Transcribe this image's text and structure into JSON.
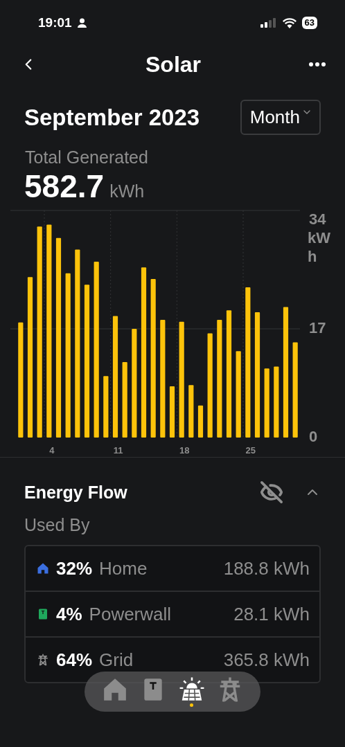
{
  "status_bar": {
    "time": "19:01",
    "battery": "63"
  },
  "nav": {
    "title": "Solar"
  },
  "period": {
    "label": "September 2023",
    "range": "Month"
  },
  "total": {
    "label": "Total Generated",
    "value": "582.7",
    "unit": "kWh"
  },
  "chart_data": {
    "type": "bar",
    "ylabel": "kWh",
    "x": [
      1,
      2,
      3,
      4,
      5,
      6,
      7,
      8,
      9,
      10,
      11,
      12,
      13,
      14,
      15,
      16,
      17,
      18,
      19,
      20,
      21,
      22,
      23,
      24,
      25,
      26,
      27,
      28,
      29,
      30
    ],
    "series": [
      {
        "color": "#fdc30a",
        "values": [
          18.0,
          25.1,
          33.0,
          33.3,
          31.2,
          25.7,
          29.4,
          23.9,
          27.5,
          9.6,
          19.0,
          11.8,
          17.0,
          26.6,
          24.8,
          18.4,
          8.0,
          18.1,
          8.2,
          5.0,
          16.3,
          18.4,
          19.9,
          13.5,
          23.5,
          19.6,
          10.8,
          11.1,
          20.4,
          14.9
        ]
      }
    ],
    "xlim": [
      0.5,
      30.5
    ],
    "ylim": [
      0,
      34
    ],
    "yticks": [
      0,
      17,
      34
    ],
    "xticks": [
      4,
      11,
      18,
      25
    ]
  },
  "energy_flow": {
    "title": "Energy Flow",
    "expanded": true,
    "subtitle": "Used By",
    "rows": [
      {
        "kind": "home",
        "color": "#3b6fe0",
        "percent": "32%",
        "label": "Home",
        "value": "188.8 kWh"
      },
      {
        "kind": "powerwall",
        "color": "#1fa85c",
        "percent": "4%",
        "label": "Powerwall",
        "value": "28.1 kWh"
      },
      {
        "kind": "grid",
        "color": "#8e8e8e",
        "percent": "64%",
        "label": "Grid",
        "value": "365.8 kWh"
      }
    ]
  },
  "tab_bar": [
    {
      "kind": "home",
      "selected": false
    },
    {
      "kind": "powerwall",
      "selected": false
    },
    {
      "kind": "solar",
      "selected": true
    },
    {
      "kind": "grid",
      "selected": false
    }
  ]
}
